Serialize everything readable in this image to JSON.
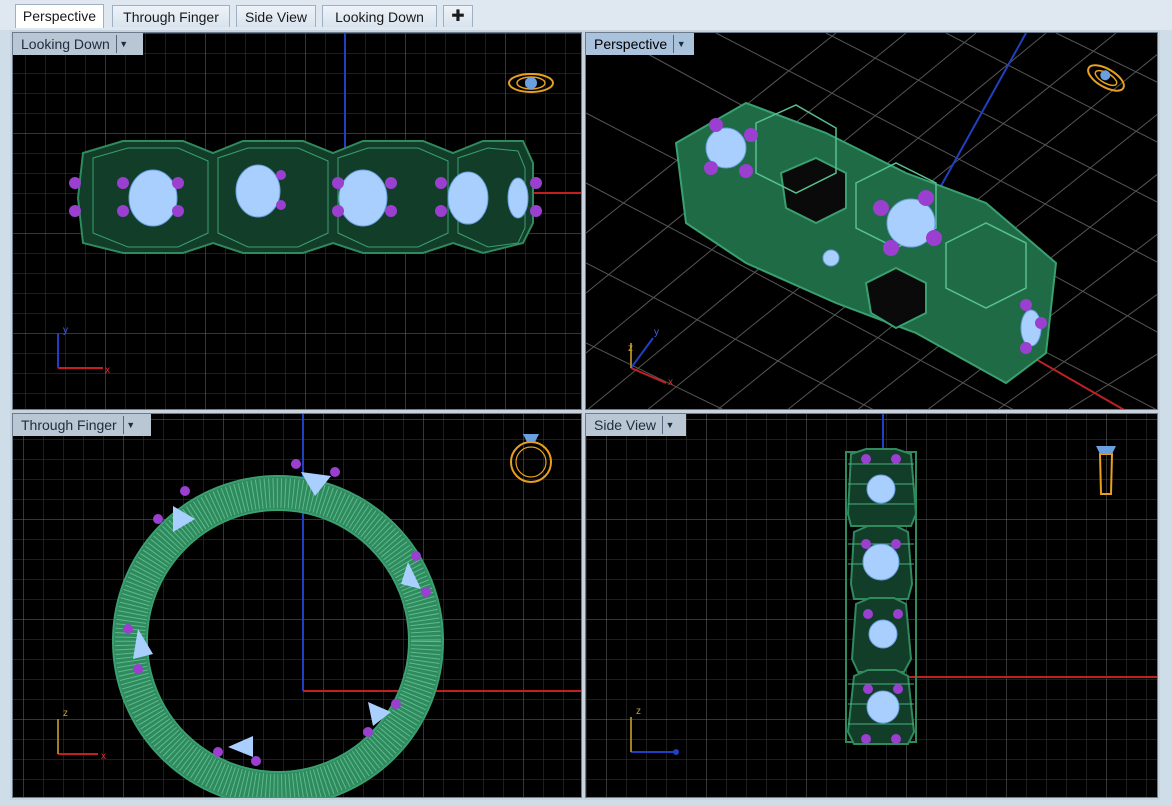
{
  "tabs": [
    {
      "label": "Perspective",
      "active": true
    },
    {
      "label": "Through Finger",
      "active": false
    },
    {
      "label": "Side View",
      "active": false
    },
    {
      "label": "Looking Down",
      "active": false
    }
  ],
  "add_tab_icon": "plus-icon",
  "viewports": {
    "top_left": {
      "label": "Looking Down",
      "gizmo": {
        "v": "y",
        "h": "x"
      }
    },
    "top_right": {
      "label": "Perspective",
      "gizmo": {
        "v": "y",
        "z": "z",
        "h": "x"
      }
    },
    "bottom_left": {
      "label": "Through Finger",
      "gizmo": {
        "v": "z",
        "h": "x"
      }
    },
    "bottom_right": {
      "label": "Side View",
      "gizmo": {
        "v": "z"
      }
    }
  },
  "colors": {
    "wire_green": "#2f8a5e",
    "stone_blue": "#a9cfff",
    "prong_purple": "#9a3fd0",
    "nav_cube_orange": "#e8a020",
    "grid": "#4a4a4a",
    "axis_x": "#c02020",
    "axis_y": "#2040c0"
  }
}
